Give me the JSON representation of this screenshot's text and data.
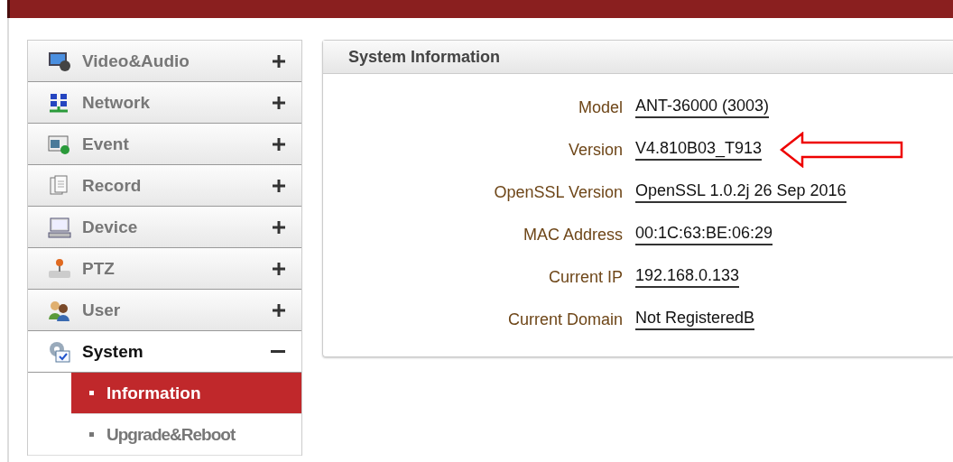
{
  "menu": [
    {
      "label": "Video&Audio",
      "expanded": false
    },
    {
      "label": "Network",
      "expanded": false
    },
    {
      "label": "Event",
      "expanded": false
    },
    {
      "label": "Record",
      "expanded": false
    },
    {
      "label": "Device",
      "expanded": false
    },
    {
      "label": "PTZ",
      "expanded": false
    },
    {
      "label": "User",
      "expanded": false
    },
    {
      "label": "System",
      "expanded": true,
      "children": [
        {
          "label": "Information",
          "selected": true
        },
        {
          "label": "Upgrade&Reboot",
          "selected": false
        }
      ]
    }
  ],
  "panel": {
    "title": "System Information",
    "fields": [
      {
        "label": "Model",
        "value": "ANT-36000 (3003)",
        "highlighted": false
      },
      {
        "label": "Version",
        "value": "V4.810B03_T913",
        "highlighted": true
      },
      {
        "label": "OpenSSL Version",
        "value": "OpenSSL 1.0.2j 26 Sep 2016",
        "highlighted": false
      },
      {
        "label": "MAC Address",
        "value": "00:1C:63:BE:06:29",
        "highlighted": false
      },
      {
        "label": "Current IP",
        "value": "192.168.0.133",
        "highlighted": false
      },
      {
        "label": "Current Domain",
        "value": "Not RegisteredB",
        "highlighted": false
      }
    ]
  }
}
